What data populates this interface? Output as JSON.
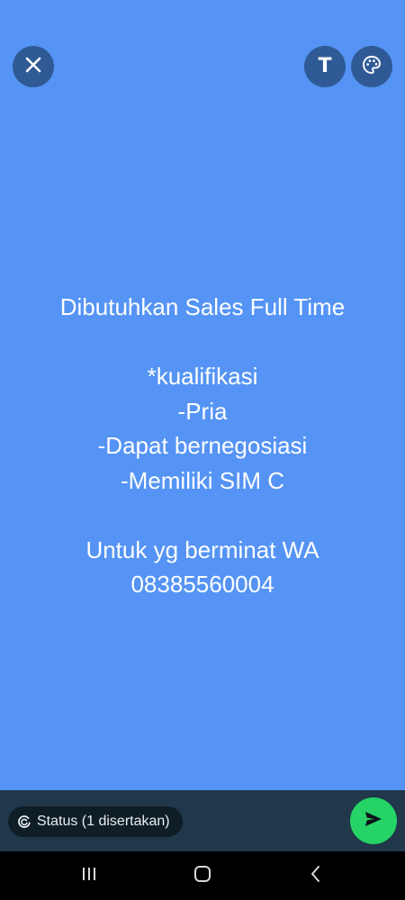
{
  "toolbar": {
    "close_icon": "close-icon",
    "text_tool_label": "T",
    "palette_icon": "palette-icon"
  },
  "status_text": {
    "line1": "Dibutuhkan Sales Full Time",
    "line2": "*kualifikasi",
    "line3": "-Pria",
    "line4": "-Dapat bernegosiasi",
    "line5": "-Memiliki SIM C",
    "line6": "Untuk yg berminat WA",
    "line7": "08385560004"
  },
  "bottom_bar": {
    "audience_label": "Status (1 disertakan)",
    "send_icon": "send-icon"
  },
  "nav": {
    "recents_icon": "recents-icon",
    "home_icon": "home-icon",
    "back_icon": "back-icon"
  },
  "colors": {
    "background": "#5594f5",
    "button_bg": "#2f5a96",
    "bottom_bar_bg": "#20384a",
    "send_button": "#25d366"
  }
}
